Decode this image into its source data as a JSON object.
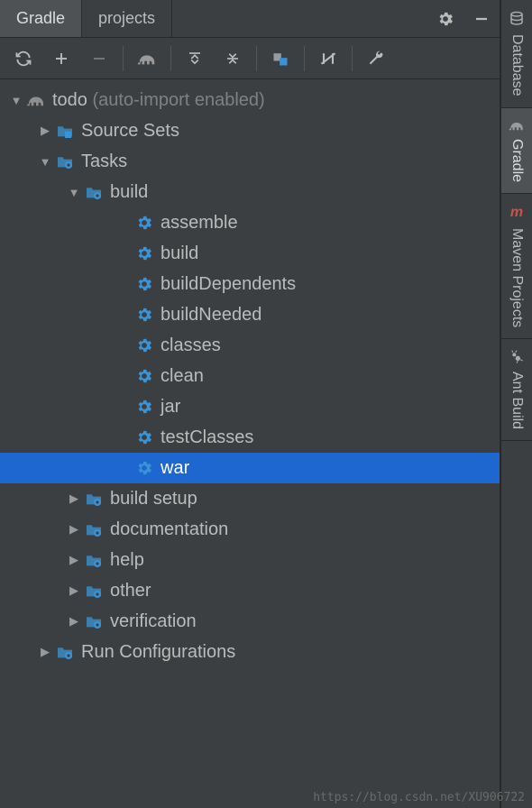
{
  "tabs": {
    "gradle": "Gradle",
    "projects": "projects"
  },
  "sidebar": {
    "database": "Database",
    "gradle": "Gradle",
    "maven": "Maven Projects",
    "ant": "Ant Build"
  },
  "tree": {
    "root_label": "todo",
    "root_hint": "(auto-import enabled)",
    "source_sets": "Source Sets",
    "tasks": "Tasks",
    "build_group": "build",
    "tasks_build": {
      "assemble": "assemble",
      "build": "build",
      "buildDependents": "buildDependents",
      "buildNeeded": "buildNeeded",
      "classes": "classes",
      "clean": "clean",
      "jar": "jar",
      "testClasses": "testClasses",
      "war": "war"
    },
    "build_setup": "build setup",
    "documentation": "documentation",
    "help": "help",
    "other": "other",
    "verification": "verification",
    "run_configs": "Run Configurations"
  },
  "watermark": "https://blog.csdn.net/XU906722"
}
